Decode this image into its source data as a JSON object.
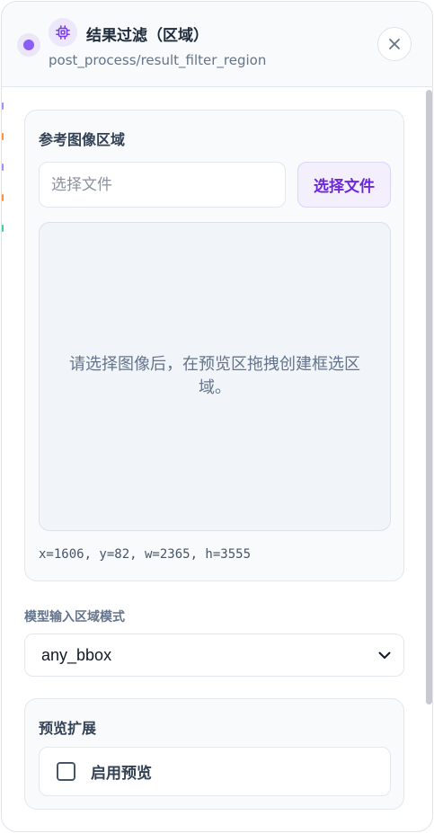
{
  "header": {
    "title": "结果过滤（区域）",
    "subtitle": "post_process/result_filter_region",
    "status_icon": "status-dot-icon",
    "node_icon": "chip-icon",
    "close_icon": "close-icon"
  },
  "reference_region": {
    "title": "参考图像区域",
    "file_input": {
      "value": "",
      "placeholder": "选择文件"
    },
    "choose_button": "选择文件",
    "preview_hint": "请选择图像后，在预览区拖拽创建框选区域。",
    "coords": "x=1606, y=82, w=2365, h=3555"
  },
  "model_input_mode": {
    "label": "模型输入区域模式",
    "selected": "any_bbox"
  },
  "preview_expand": {
    "title": "预览扩展",
    "checkbox_label": "启用预览",
    "checked": false
  },
  "colors": {
    "accent": "#8b5cf6",
    "accent_text": "#6d28d9",
    "accent_bg": "#f3effd"
  }
}
